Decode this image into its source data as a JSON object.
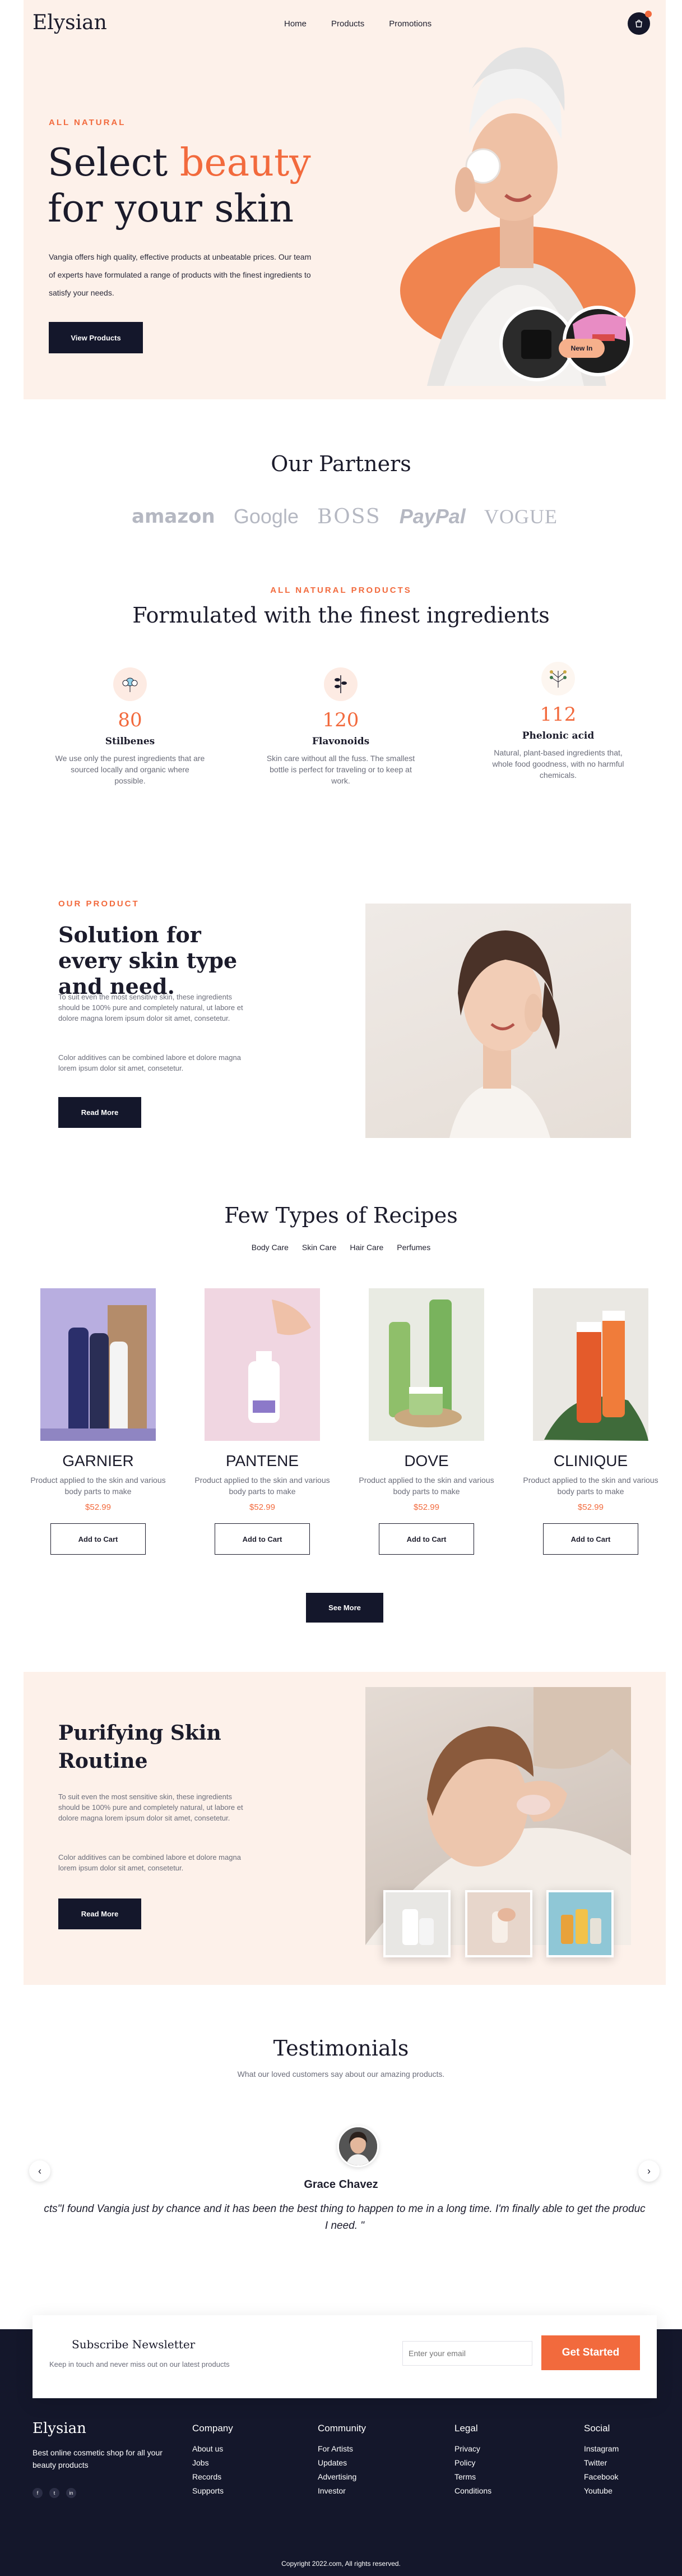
{
  "header": {
    "logo": "Elysian",
    "nav": [
      "Home",
      "Products",
      "Promotions"
    ],
    "cart_icon": "shopping-bag-icon"
  },
  "hero": {
    "eyebrow": "ALL NATURAL",
    "title_line1_plain": "Select ",
    "title_line1_accent": "beauty",
    "title_line2": "for your skin",
    "description": "Vangia offers high quality, effective products at unbeatable prices. Our team of experts have formulated a range of products with the finest ingredients to satisfy your needs.",
    "button": "View Products",
    "chip": "New In",
    "accent_color": "#f26a3d"
  },
  "partners": {
    "title": "Our Partners",
    "logos": [
      "amazon",
      "Google",
      "BOSS",
      "PayPal",
      "VOGUE"
    ]
  },
  "ingredients": {
    "eyebrow": "ALL NATURAL PRODUCTS",
    "title": "Formulated with the finest ingredients",
    "items": [
      {
        "icon": "flower-icon",
        "value": "80",
        "name": "Stilbenes",
        "desc": "We use only the purest ingredients that are sourced locally and organic where possible."
      },
      {
        "icon": "leaf-branch-icon",
        "value": "120",
        "name": "Flavonoids",
        "desc": "Skin care without all the fuss. The smallest bottle is perfect for traveling or to keep at work."
      },
      {
        "icon": "herb-icon",
        "value": "112",
        "name": "Phelonic acid",
        "desc": "Natural, plant-based ingredients that, whole food goodness, with no harmful chemicals."
      }
    ]
  },
  "product": {
    "eyebrow": "OUR PRODUCT",
    "title": "Solution for every skin type and need.",
    "para1": "To suit even the most sensitive skin, these ingredients should be 100% pure and completely natural, ut labore et dolore magna lorem ipsum dolor sit amet, consetetur.",
    "para2": "Color additives can be combined labore et dolore magna lorem ipsum dolor sit amet, consetetur.",
    "button": "Read More"
  },
  "recipes": {
    "title": "Few Types of Recipes",
    "tabs": [
      "Body Care",
      "Skin Care",
      "Hair Care",
      "Perfumes"
    ],
    "cards": [
      {
        "brand": "GARNIER",
        "desc": "Product applied to the skin and various body parts to make",
        "price": "$52.99",
        "button": "Add to Cart"
      },
      {
        "brand": "PANTENE",
        "desc": "Product applied to the skin and various body parts to make",
        "price": "$52.99",
        "button": "Add to Cart"
      },
      {
        "brand": "DOVE",
        "desc": "Product applied to the skin and various body parts to make",
        "price": "$52.99",
        "button": "Add to Cart"
      },
      {
        "brand": "CLINIQUE",
        "desc": "Product applied to the skin and various body parts to make",
        "price": "$52.99",
        "button": "Add to Cart"
      }
    ],
    "see_more": "See More"
  },
  "purifying": {
    "title": "Purifying Skin Routine",
    "para1": "To suit even the most sensitive skin, these ingredients should be 100% pure and completely natural, ut labore et dolore magna lorem ipsum dolor sit amet, consetetur.",
    "para2": "Color additives can be combined labore et dolore magna lorem ipsum dolor sit amet, consetetur.",
    "button": "Read More"
  },
  "testimonials": {
    "title": "Testimonials",
    "subtitle": "What our loved customers say about our amazing products.",
    "name": "Grace Chavez",
    "quote": "cts\"I found Vangia just by chance and it has been the best thing to happen to me in a long time. I'm finally able to get the produc",
    "quote_line2": "I need. \"",
    "prev": "‹",
    "next": "›"
  },
  "newsletter": {
    "title": "Subscribe Newsletter",
    "subtitle": "Keep in touch and never miss out on our latest products",
    "placeholder": "Enter your email",
    "button": "Get Started"
  },
  "footer": {
    "logo": "Elysian",
    "desc": "Best online cosmetic shop for all your beauty products",
    "social": [
      "f",
      "t",
      "in"
    ],
    "columns": [
      {
        "heading": "Company",
        "items": [
          "About us",
          "Jobs",
          "Records",
          "Supports"
        ]
      },
      {
        "heading": "Community",
        "items": [
          "For Artists",
          "Updates",
          "Advertising",
          "Investor"
        ]
      },
      {
        "heading": "Legal",
        "items": [
          "Privacy",
          "Policy",
          "Terms",
          "Conditions"
        ]
      },
      {
        "heading": "Social",
        "items": [
          "Instagram",
          "Twitter",
          "Facebook",
          "Youtube"
        ]
      }
    ],
    "copyright": "Copyright 2022.com, All rights reserved."
  }
}
